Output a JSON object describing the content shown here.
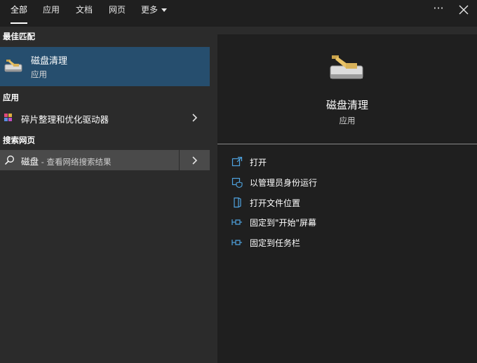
{
  "tabs": [
    {
      "label": "全部",
      "active": true
    },
    {
      "label": "应用",
      "active": false
    },
    {
      "label": "文档",
      "active": false
    },
    {
      "label": "网页",
      "active": false
    },
    {
      "label": "更多",
      "active": false
    }
  ],
  "toolbar": {
    "more_label": "···"
  },
  "left": {
    "best_match_header": "最佳匹配",
    "best_match": {
      "title": "磁盘清理",
      "subtitle": "应用",
      "icon": "disk-cleanup-icon"
    },
    "apps_header": "应用",
    "apps": [
      {
        "label": "碎片整理和优化驱动器",
        "icon": "defrag-icon"
      }
    ],
    "web_header": "搜索网页",
    "web": {
      "query": "磁盘",
      "suffix": " - 查看网络搜索结果",
      "icon": "search-icon"
    }
  },
  "right": {
    "app_title": "磁盘清理",
    "app_type": "应用",
    "actions": [
      {
        "label": "打开",
        "icon": "open-icon"
      },
      {
        "label": "以管理员身份运行",
        "icon": "run-as-admin-icon"
      },
      {
        "label": "打开文件位置",
        "icon": "file-location-icon"
      },
      {
        "label": "固定到\"开始\"屏幕",
        "icon": "pin-icon"
      },
      {
        "label": "固定到任务栏",
        "icon": "pin-icon"
      }
    ]
  },
  "colors": {
    "accent": "#264e6e",
    "icon_blue": "#4fa3e0"
  }
}
